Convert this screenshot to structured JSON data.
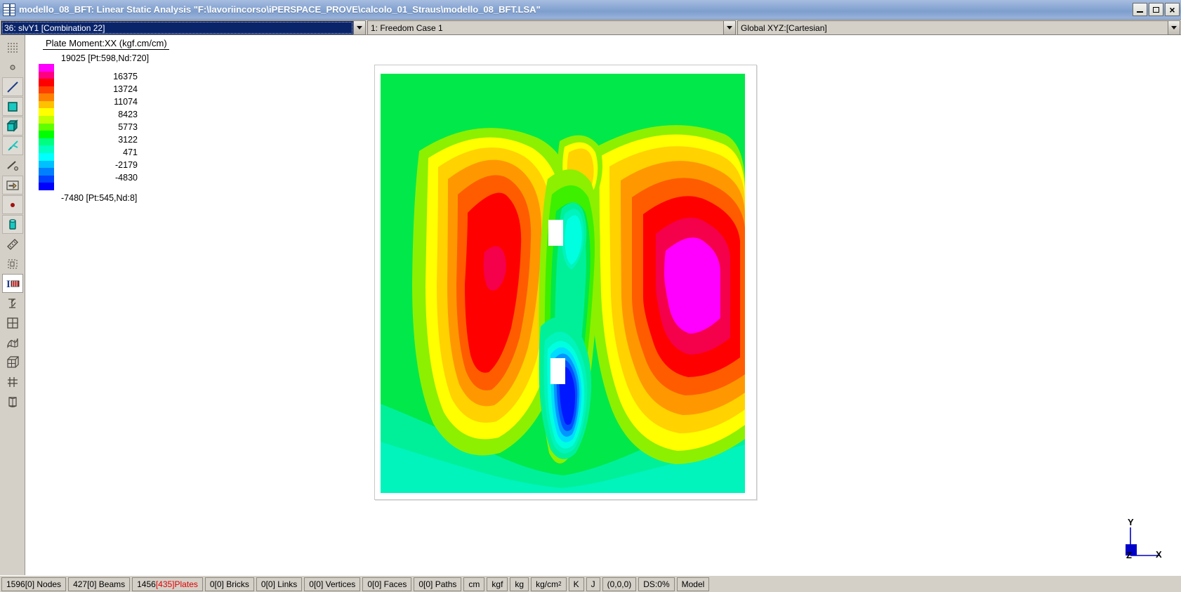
{
  "window": {
    "title": "modello_08_BFT: Linear Static Analysis \"F:\\lavoriincorso\\iPERSPACE_PROVE\\calcolo_01_Straus\\modello_08_BFT.LSA\"",
    "icon": "grid-window-icon",
    "minimize_label": "",
    "maximize_label": "",
    "close_label": "×"
  },
  "toolbar": {
    "result_case": "36: slvY1 [Combination 22]",
    "freedom_case": "1: Freedom Case 1",
    "coordinate_system": "Global XYZ:[Cartesian]"
  },
  "tools": [
    {
      "name": "select-by-region-icon",
      "label": "Select by Region"
    },
    {
      "name": "select-node-icon",
      "label": "Select Node"
    },
    {
      "name": "select-beam-icon",
      "label": "Select Beam"
    },
    {
      "name": "select-plate-icon",
      "label": "Select Plate"
    },
    {
      "name": "select-brick-icon",
      "label": "Select Brick"
    },
    {
      "name": "select-link-icon",
      "label": "Select Link"
    },
    {
      "name": "select-vertex-icon",
      "label": "Select Vertex"
    },
    {
      "name": "select-face-icon",
      "label": "Select Face"
    },
    {
      "name": "node-display-icon",
      "label": "Node Display"
    },
    {
      "name": "cylinder-display-icon",
      "label": "Solid Display"
    },
    {
      "name": "measure-icon",
      "label": "Measure"
    },
    {
      "name": "copy-region-icon",
      "label": "Copy Region"
    },
    {
      "name": "text-annotation-icon",
      "label": "Text / Annotation"
    },
    {
      "name": "support-icon",
      "label": "Supports"
    },
    {
      "name": "mesh-grid-icon",
      "label": "Mesh Grid"
    },
    {
      "name": "plate-surface-icon",
      "label": "Plate Surface"
    },
    {
      "name": "brick-mesh-icon",
      "label": "Brick Mesh"
    },
    {
      "name": "restraint-icon",
      "label": "Restraint"
    },
    {
      "name": "section-icon",
      "label": "Section"
    }
  ],
  "legend": {
    "title": "Plate Moment:XX  (kgf.cm/cm)",
    "max_label": "19025 [Pt:598,Nd:720]",
    "min_label": "-7480 [Pt:545,Nd:8]",
    "ticks": [
      "16375",
      "13724",
      "11074",
      "8423",
      "5773",
      "3122",
      "471",
      "-2179",
      "-4830"
    ],
    "colors": [
      "#ff00ff",
      "#ff0080",
      "#ff0000",
      "#ff4000",
      "#ff8000",
      "#ffc000",
      "#ffff00",
      "#c0ff00",
      "#60ff00",
      "#00ff00",
      "#00ff80",
      "#00ffc0",
      "#00ffff",
      "#00c0ff",
      "#0080ff",
      "#0040ff",
      "#0000ff"
    ]
  },
  "chart_data": {
    "type": "heatmap",
    "title": "Plate Moment:XX  (kgf.cm/cm)",
    "units": "kgf.cm/cm",
    "quantity": "Plate Moment:XX",
    "contour_levels": [
      -7480,
      -4830,
      -2179,
      471,
      3122,
      5773,
      8423,
      11074,
      13724,
      16375,
      19025
    ],
    "min": -7480,
    "max": 19025,
    "min_location": "Pt:545,Nd:8",
    "max_location": "Pt:598,Nd:720",
    "legend_position": "top-left",
    "description": "Contour fringe plot of plate bending moment XX over a rectangular slab with two rectangular openings; two positive moment hot-spots (left red, right magenta peak) and one negative moment cold-spot (blue) below the lower opening."
  },
  "axes_triad": {
    "x_label": "X",
    "y_label": "Y",
    "z_label": "Z",
    "color": "#0000c0"
  },
  "statusbar": [
    {
      "name": "nodes",
      "text": "1596[0] Nodes",
      "highlight": ""
    },
    {
      "name": "beams",
      "text": "427[0] Beams",
      "highlight": ""
    },
    {
      "name": "plates",
      "prefix": "1456",
      "highlight": "[435]",
      "suffix": " Plates"
    },
    {
      "name": "bricks",
      "text": "0[0] Bricks",
      "highlight": ""
    },
    {
      "name": "links",
      "text": "0[0] Links",
      "highlight": ""
    },
    {
      "name": "vertices",
      "text": "0[0] Vertices",
      "highlight": ""
    },
    {
      "name": "faces",
      "text": "0[0] Faces",
      "highlight": ""
    },
    {
      "name": "paths",
      "text": "0[0] Paths",
      "highlight": ""
    },
    {
      "name": "unit-length",
      "text": "cm",
      "highlight": ""
    },
    {
      "name": "unit-force",
      "text": "kgf",
      "highlight": ""
    },
    {
      "name": "unit-mass",
      "text": "kg",
      "highlight": ""
    },
    {
      "name": "unit-stress",
      "text": "kg/cm2",
      "highlight": ""
    },
    {
      "name": "unit-temperature",
      "text": "K",
      "highlight": ""
    },
    {
      "name": "unit-energy",
      "text": "J",
      "highlight": ""
    },
    {
      "name": "cursor-coords",
      "text": "(0,0,0)",
      "highlight": ""
    },
    {
      "name": "display-scale",
      "text": "DS:0%",
      "highlight": ""
    },
    {
      "name": "view-mode",
      "text": "Model",
      "highlight": ""
    }
  ]
}
